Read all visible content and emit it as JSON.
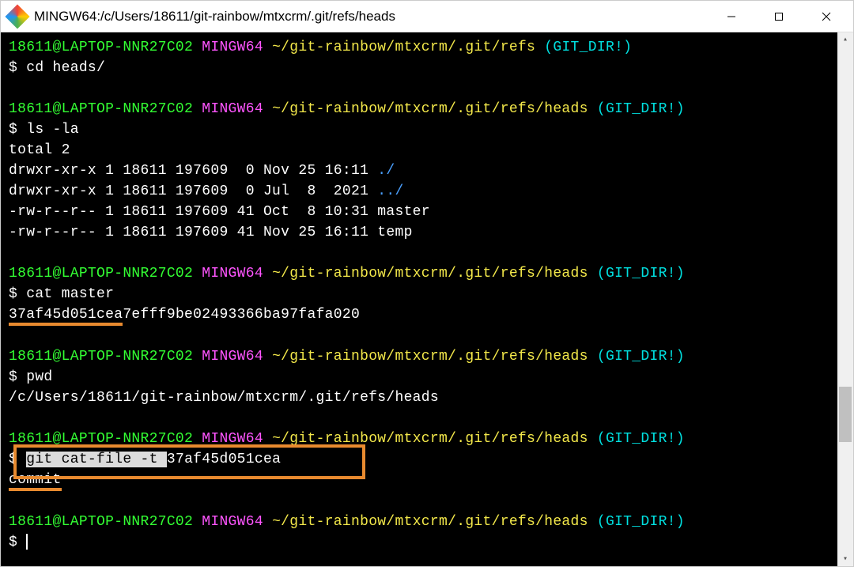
{
  "titlebar": {
    "title": "MINGW64:/c/Users/18611/git-rainbow/mtxcrm/.git/refs/heads"
  },
  "prompt": {
    "user": "18611@LAPTOP-NNR27C02",
    "env": "MINGW64",
    "path_refs": "~/git-rainbow/mtxcrm/.git/refs",
    "path_heads": "~/git-rainbow/mtxcrm/.git/refs/heads",
    "git_dir": "(GIT_DIR!)",
    "dollar": "$"
  },
  "cmds": {
    "cd": "cd heads/",
    "ls": "ls -la",
    "cat": "cat master",
    "pwd": "pwd",
    "git_pre": "git cat-file -t ",
    "git_hash": "37af45d051cea"
  },
  "out": {
    "ls_total": "total 2",
    "ls1": "drwxr-xr-x 1 18611 197609  0 Nov 25 16:11 ",
    "ls1d": "./",
    "ls2": "drwxr-xr-x 1 18611 197609  0 Jul  8  2021 ",
    "ls2d": "../",
    "ls3": "-rw-r--r-- 1 18611 197609 41 Oct  8 10:31 master",
    "ls4": "-rw-r--r-- 1 18611 197609 41 Nov 25 16:11 temp",
    "hash_prefix": "37af45d051cea",
    "hash_rest": "7efff9be02493366ba97fafa020",
    "pwd_out": "/c/Users/18611/git-rainbow/mtxcrm/.git/refs/heads",
    "commit": "commit"
  }
}
